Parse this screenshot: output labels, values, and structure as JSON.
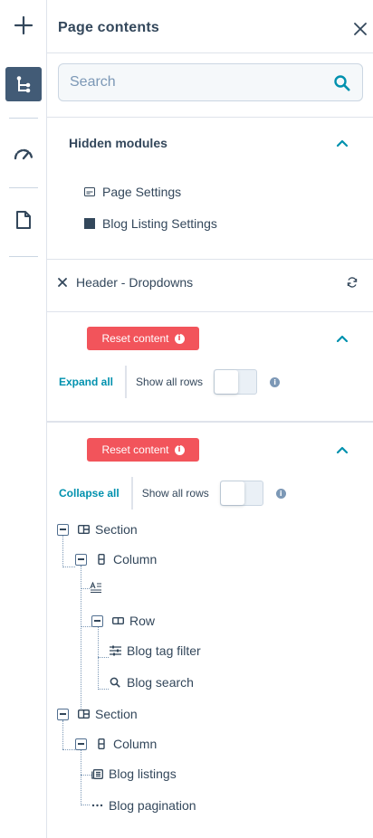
{
  "rail": {
    "items": [
      {
        "icon": "plus-icon",
        "active": false
      },
      {
        "icon": "tree-structure-icon",
        "active": true
      },
      {
        "icon": "speedometer-icon",
        "active": false
      },
      {
        "icon": "document-icon",
        "active": false
      }
    ]
  },
  "panel": {
    "title": "Page contents",
    "close_icon": "close-icon"
  },
  "search": {
    "placeholder": "Search",
    "value": ""
  },
  "hidden_modules": {
    "title": "Hidden modules",
    "items": [
      {
        "label": "Page Settings",
        "icon": "settings-chip-icon"
      },
      {
        "label": "Blog Listing Settings",
        "icon": "square-icon"
      }
    ]
  },
  "header_item": {
    "label": "Header - Dropdowns",
    "icon": "x-icon",
    "action_icon": "sync-icon"
  },
  "group1": {
    "reset_label": "Reset content",
    "expand_label": "Expand all",
    "show_rows_label": "Show all rows",
    "show_rows_on": false
  },
  "group2": {
    "reset_label": "Reset content",
    "collapse_label": "Collapse all",
    "show_rows_label": "Show all rows",
    "show_rows_on": false
  },
  "tree": {
    "section1": "Section",
    "column1": "Column",
    "row1": "Row",
    "blog_tag_filter": "Blog tag filter",
    "blog_search": "Blog search",
    "section2": "Section",
    "column2": "Column",
    "blog_listings": "Blog listings",
    "blog_pagination": "Blog pagination"
  },
  "colors": {
    "accent": "#0091ae",
    "danger": "#f2545b",
    "text": "#33475b",
    "rail_active": "#425b76"
  }
}
